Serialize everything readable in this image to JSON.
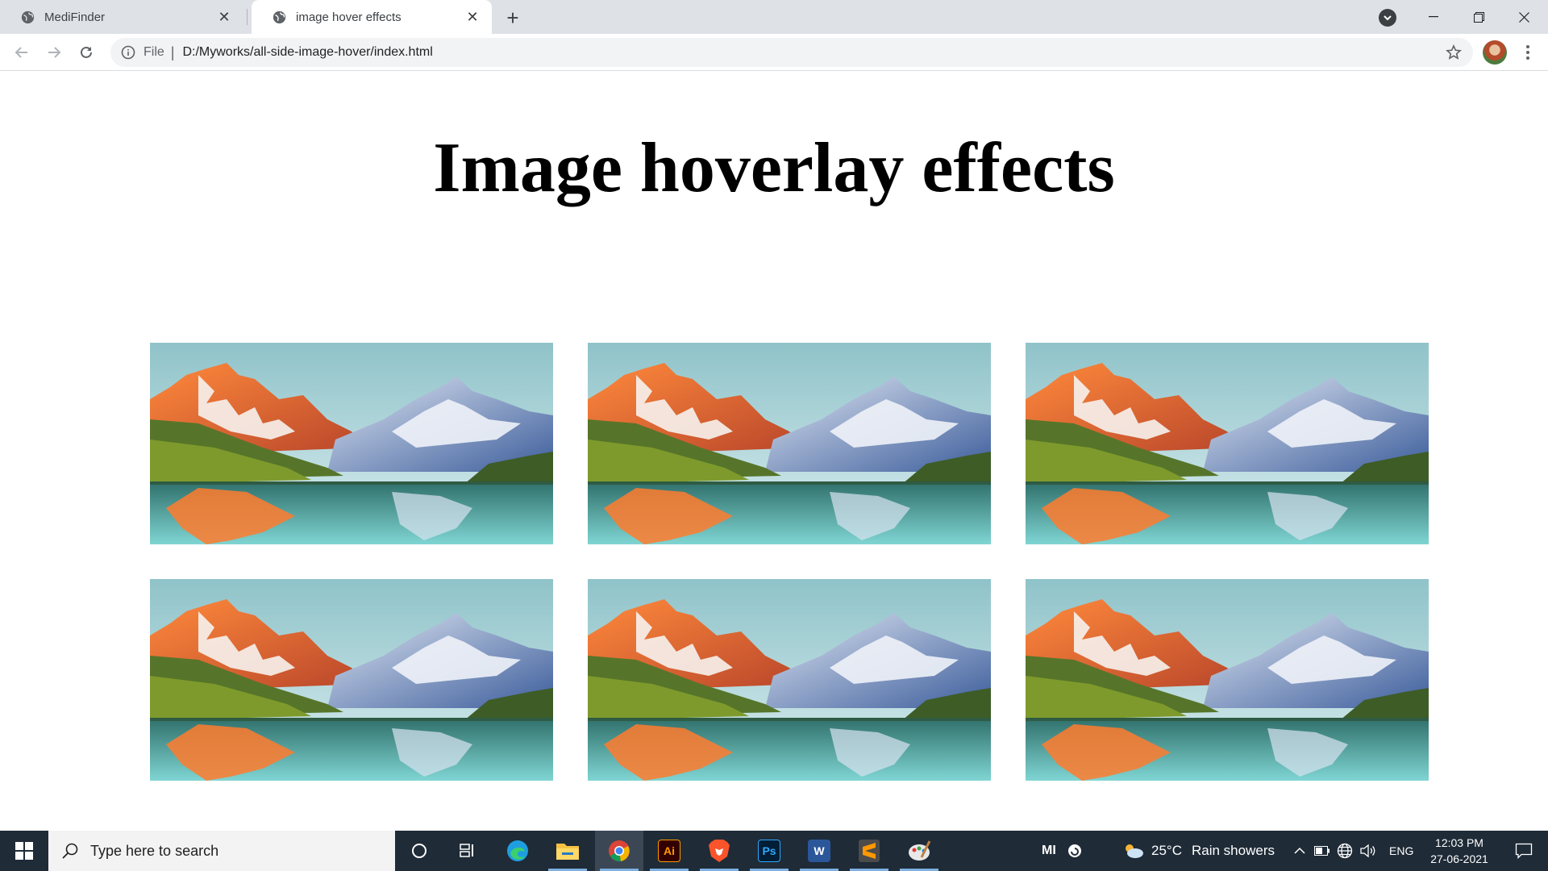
{
  "browser": {
    "tabs": [
      {
        "title": "MediFinder",
        "active": false
      },
      {
        "title": "image hover effects",
        "active": true
      }
    ],
    "address": {
      "scheme_label": "File",
      "url": "D:/Myworks/all-side-image-hover/index.html"
    },
    "icons": {
      "back": "arrow-left-icon",
      "forward": "arrow-right-icon",
      "reload": "reload-icon",
      "info": "info-icon",
      "bookmark": "star-icon",
      "menu": "kebab-menu-icon",
      "tab_search": "tab-search-icon",
      "new_tab": "plus-icon"
    }
  },
  "page": {
    "title": "Image hoverlay effects",
    "gallery": [
      {
        "alt": "mountain lake landscape"
      },
      {
        "alt": "mountain lake landscape"
      },
      {
        "alt": "mountain lake landscape"
      },
      {
        "alt": "mountain lake landscape"
      },
      {
        "alt": "mountain lake landscape"
      },
      {
        "alt": "mountain lake landscape"
      }
    ]
  },
  "taskbar": {
    "search_placeholder": "Type here to search",
    "apps": [
      "cortana",
      "task-view",
      "edge",
      "file-explorer",
      "chrome",
      "illustrator",
      "brave",
      "photoshop",
      "word",
      "sublime-text",
      "paint"
    ],
    "ai_label": "Ai",
    "ps_label": "Ps",
    "word_label": "W",
    "mi_label": "MI",
    "weather": {
      "temp": "25°C",
      "condition": "Rain showers"
    },
    "language": "ENG",
    "time": "12:03 PM",
    "date": "27-06-2021"
  },
  "colors": {
    "tabbar_bg": "#dee1e6",
    "taskbar_bg": "#1f2b37",
    "omnibox_bg": "#f1f3f4"
  }
}
